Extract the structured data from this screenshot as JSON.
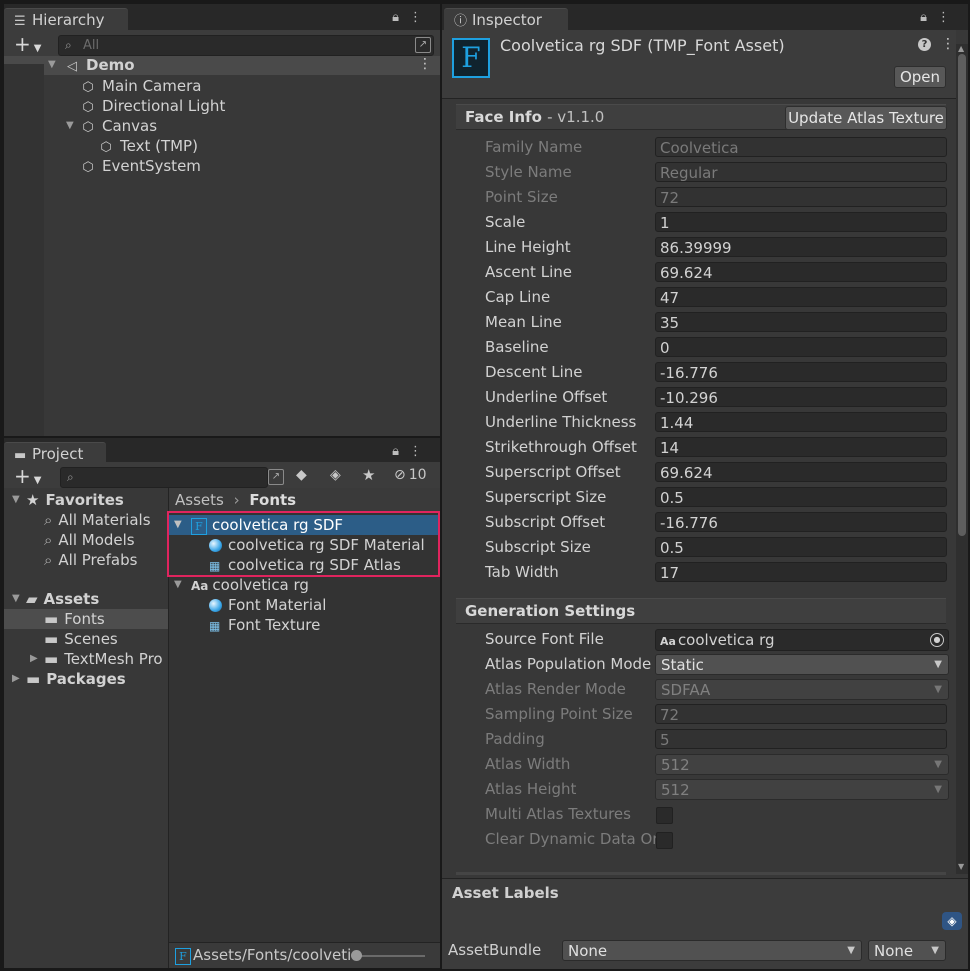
{
  "hierarchy": {
    "tab_label": "Hierarchy",
    "search_placeholder": "All",
    "scene_name": "Demo",
    "items": [
      {
        "label": "Main Camera"
      },
      {
        "label": "Directional Light"
      },
      {
        "label": "Canvas"
      },
      {
        "label": "Text (TMP)"
      },
      {
        "label": "EventSystem"
      }
    ]
  },
  "project": {
    "tab_label": "Project",
    "hidden_count": "10",
    "favorites": {
      "label": "Favorites",
      "items": [
        "All Materials",
        "All Models",
        "All Prefabs"
      ]
    },
    "assets_root": "Assets",
    "folders": [
      "Fonts",
      "Scenes",
      "TextMesh Pro"
    ],
    "packages": "Packages",
    "breadcrumb": [
      "Assets",
      "Fonts"
    ],
    "files": [
      {
        "label": "coolvetica rg SDF"
      },
      {
        "label": "coolvetica rg SDF Material"
      },
      {
        "label": "coolvetica rg SDF Atlas"
      },
      {
        "label": "coolvetica rg"
      },
      {
        "label": "Font Material"
      },
      {
        "label": "Font Texture"
      }
    ],
    "status_path": "Assets/Fonts/coolveti"
  },
  "inspector": {
    "tab_label": "Inspector",
    "asset_title": "Coolvetica rg SDF (TMP_Font Asset)",
    "open_button": "Open",
    "face_info": {
      "title": "Face Info",
      "version": "- v1.1.0",
      "update_button": "Update Atlas Texture",
      "props": [
        {
          "label": "Family Name",
          "value": "Coolvetica"
        },
        {
          "label": "Style Name",
          "value": "Regular"
        },
        {
          "label": "Point Size",
          "value": "72"
        },
        {
          "label": "Scale",
          "value": "1"
        },
        {
          "label": "Line Height",
          "value": "86.39999"
        },
        {
          "label": "Ascent Line",
          "value": "69.624"
        },
        {
          "label": "Cap Line",
          "value": "47"
        },
        {
          "label": "Mean Line",
          "value": "35"
        },
        {
          "label": "Baseline",
          "value": "0"
        },
        {
          "label": "Descent Line",
          "value": "-16.776"
        },
        {
          "label": "Underline Offset",
          "value": "-10.296"
        },
        {
          "label": "Underline Thickness",
          "value": "1.44"
        },
        {
          "label": "Strikethrough Offset",
          "value": "14"
        },
        {
          "label": "Superscript Offset",
          "value": "69.624"
        },
        {
          "label": "Superscript Size",
          "value": "0.5"
        },
        {
          "label": "Subscript Offset",
          "value": "-16.776"
        },
        {
          "label": "Subscript Size",
          "value": "0.5"
        },
        {
          "label": "Tab Width",
          "value": "17"
        }
      ]
    },
    "generation": {
      "title": "Generation Settings",
      "source_font_label": "Source Font File",
      "source_font_value": "coolvetica rg",
      "atlas_population_label": "Atlas Population Mode",
      "atlas_population_value": "Static",
      "atlas_render_label": "Atlas Render Mode",
      "atlas_render_value": "SDFAA",
      "sampling_label": "Sampling Point Size",
      "sampling_value": "72",
      "padding_label": "Padding",
      "padding_value": "5",
      "atlas_width_label": "Atlas Width",
      "atlas_width_value": "512",
      "atlas_height_label": "Atlas Height",
      "atlas_height_value": "512",
      "multi_atlas_label": "Multi Atlas Textures",
      "clear_dynamic_label": "Clear Dynamic Data On"
    },
    "asset_labels": "Asset Labels",
    "asset_bundle_label": "AssetBundle",
    "asset_bundle_value": "None",
    "asset_bundle_variant": "None"
  },
  "colors": {
    "selection": "#2c5d87",
    "highlight_box": "#e0245e",
    "font_icon": "#1ea0e0"
  }
}
